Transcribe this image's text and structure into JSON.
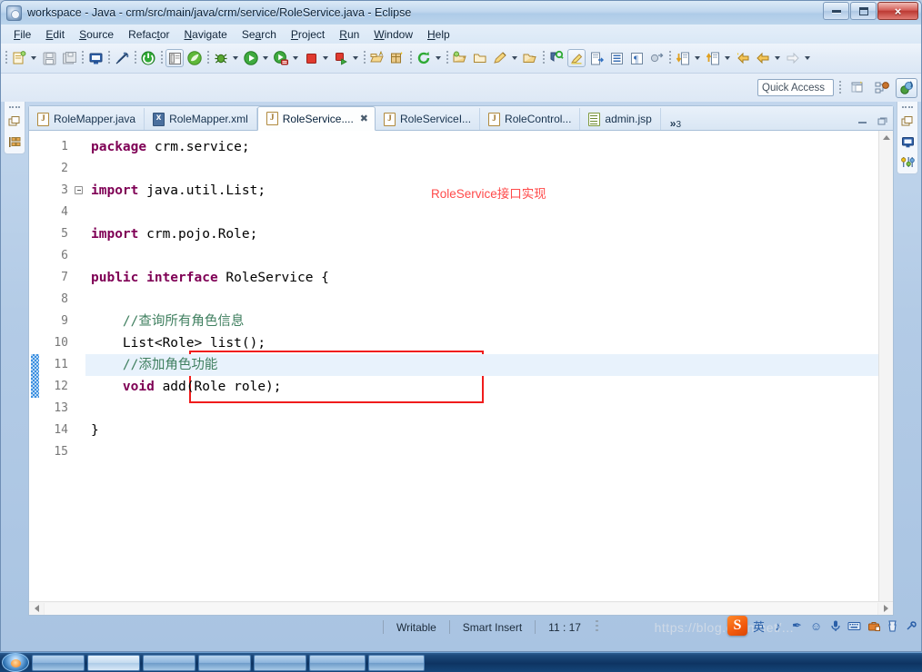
{
  "window": {
    "title": "workspace - Java - crm/src/main/java/crm/service/RoleService.java - Eclipse",
    "icon": "eclipse-icon",
    "controls": {
      "minimize": "minimize-button",
      "maximize": "maximize-button",
      "close": "×"
    }
  },
  "menubar": {
    "items": [
      {
        "label": "File",
        "mnemonic": "F"
      },
      {
        "label": "Edit",
        "mnemonic": "E"
      },
      {
        "label": "Source",
        "mnemonic": "S"
      },
      {
        "label": "Refactor",
        "mnemonic": "t"
      },
      {
        "label": "Navigate",
        "mnemonic": "N"
      },
      {
        "label": "Search",
        "mnemonic": "a"
      },
      {
        "label": "Project",
        "mnemonic": "P"
      },
      {
        "label": "Run",
        "mnemonic": "R"
      },
      {
        "label": "Window",
        "mnemonic": "W"
      },
      {
        "label": "Help",
        "mnemonic": "H"
      }
    ]
  },
  "toolbar": {
    "icons": [
      "new-file-icon",
      "save-icon",
      "save-all-icon",
      "console-icon",
      "link-break-icon",
      "open-type-icon",
      "toggle-breadcrumb-icon",
      "spring-leaf-icon",
      "debug-icon",
      "run-icon",
      "run-server-icon",
      "terminate-icon",
      "run-external-icon",
      "new-java-project-icon",
      "new-package-icon",
      "new-class-icon",
      "refresh-icon",
      "open-type-hierarchy-icon",
      "open-task-icon",
      "search-icon",
      "next-annotation-icon",
      "previous-annotation-icon",
      "last-edit-location-icon",
      "back-icon",
      "forward-icon"
    ]
  },
  "quick_access": {
    "placeholder": "Quick Access",
    "value": "",
    "perspective_buttons": [
      {
        "name": "open-perspective-button",
        "label": "open-perspective-icon",
        "active": false
      },
      {
        "name": "perspective-java-ee-button",
        "label": "java-ee-perspective-icon",
        "active": false
      },
      {
        "name": "perspective-java-button",
        "label": "java-perspective-icon",
        "active": true
      }
    ]
  },
  "left_rail": {
    "icons": [
      "restore-view-icon",
      "package-explorer-icon"
    ]
  },
  "right_rail": {
    "icons": [
      "restore-view-icon",
      "console-view-icon",
      "outline-view-icon"
    ]
  },
  "editor": {
    "tabs": [
      {
        "label": "RoleMapper.java",
        "type": "java",
        "active": false,
        "closable": false
      },
      {
        "label": "RoleMapper.xml",
        "type": "xml",
        "active": false,
        "closable": false
      },
      {
        "label": "RoleService....",
        "type": "java",
        "active": true,
        "closable": true,
        "close_glyph": "✖"
      },
      {
        "label": "RoleServiceI...",
        "type": "java",
        "active": false,
        "closable": false
      },
      {
        "label": "RoleControl...",
        "type": "java",
        "active": false,
        "closable": false
      },
      {
        "label": "admin.jsp",
        "type": "jsp",
        "active": false,
        "closable": false
      }
    ],
    "overflow": {
      "chevron": "»",
      "count": "3"
    },
    "tab_controls": [
      "minimize-editor-icon",
      "maximize-editor-icon"
    ],
    "lines": [
      {
        "no": "1",
        "segments": [
          {
            "t": "package",
            "c": "kw"
          },
          {
            "t": " crm.service;",
            "c": ""
          }
        ],
        "fold": false,
        "changed": false,
        "highlight": false
      },
      {
        "no": "2",
        "segments": [],
        "fold": false,
        "changed": false,
        "highlight": false
      },
      {
        "no": "3",
        "segments": [
          {
            "t": "import",
            "c": "kw"
          },
          {
            "t": " java.util.List;",
            "c": ""
          }
        ],
        "fold": true,
        "changed": false,
        "highlight": false
      },
      {
        "no": "4",
        "segments": [],
        "fold": false,
        "changed": false,
        "highlight": false
      },
      {
        "no": "5",
        "segments": [
          {
            "t": "import",
            "c": "kw"
          },
          {
            "t": " crm.pojo.Role;",
            "c": ""
          }
        ],
        "fold": false,
        "changed": false,
        "highlight": false
      },
      {
        "no": "6",
        "segments": [],
        "fold": false,
        "changed": false,
        "highlight": false
      },
      {
        "no": "7",
        "segments": [
          {
            "t": "public interface",
            "c": "kw"
          },
          {
            "t": " RoleService {",
            "c": ""
          }
        ],
        "fold": false,
        "changed": false,
        "highlight": false
      },
      {
        "no": "8",
        "segments": [],
        "fold": false,
        "changed": false,
        "highlight": false
      },
      {
        "no": "9",
        "segments": [
          {
            "t": "    //查询所有角色信息",
            "c": "cm"
          }
        ],
        "fold": false,
        "changed": false,
        "highlight": false
      },
      {
        "no": "10",
        "segments": [
          {
            "t": "    List<Role> list();",
            "c": ""
          }
        ],
        "fold": false,
        "changed": false,
        "highlight": false
      },
      {
        "no": "11",
        "segments": [
          {
            "t": "    //添加角色功能",
            "c": "cm"
          }
        ],
        "fold": false,
        "changed": true,
        "highlight": true
      },
      {
        "no": "12",
        "segments": [
          {
            "t": "    ",
            "c": ""
          },
          {
            "t": "void",
            "c": "kw"
          },
          {
            "t": " add(Role role);",
            "c": ""
          }
        ],
        "fold": false,
        "changed": true,
        "highlight": false
      },
      {
        "no": "13",
        "segments": [],
        "fold": false,
        "changed": false,
        "highlight": false
      },
      {
        "no": "14",
        "segments": [
          {
            "t": "}",
            "c": ""
          }
        ],
        "fold": false,
        "changed": false,
        "highlight": false
      },
      {
        "no": "15",
        "segments": [],
        "fold": false,
        "changed": false,
        "highlight": false
      }
    ],
    "annotation": {
      "text": "RoleService接口实现",
      "color": "#ff4a4a",
      "box_color": "#f01c1c"
    }
  },
  "statusbar": {
    "writable": "Writable",
    "insert_mode": "Smart Insert",
    "cursor_position": "11 : 17"
  },
  "ime": {
    "logo": "S",
    "items": [
      "英",
      "♪",
      "✒",
      "☺",
      "🎤",
      "⌨",
      "🔧",
      "🌐",
      "🔍"
    ]
  },
  "watermark": "https://blog.csdn.net/...",
  "taskbar": {
    "start": "start-orb",
    "buttons": [
      "taskbar-item-1",
      "taskbar-item-2",
      "taskbar-item-3",
      "taskbar-item-4",
      "taskbar-item-5",
      "taskbar-item-6",
      "taskbar-item-7"
    ]
  },
  "colors": {
    "keyword": "#7f0055",
    "comment": "#3f7f5f",
    "annotation_red": "#ff4a4a",
    "highlight_line": "#e8f2fc"
  }
}
